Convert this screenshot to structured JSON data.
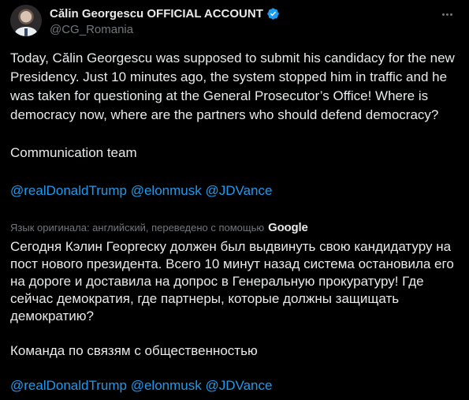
{
  "author": {
    "display_name": "Călin Georgescu OFFICIAL ACCOUNT",
    "handle": "@CG_Romania",
    "verified_icon": "verified-badge-icon",
    "more_icon": "more-horizontal-icon"
  },
  "original": {
    "paragraph1": "Today, Călin Georgescu was supposed to submit his candidacy for the new Presidency. Just 10 minutes ago, the system stopped him in traffic and he was taken for questioning at the General Prosecutor’s Office! Where is democracy now, where are the partners who should defend democracy?",
    "paragraph2": "Communication team",
    "mentions": [
      "@realDonaldTrump",
      "@elonmusk",
      "@JDVance"
    ]
  },
  "translation": {
    "note": "Язык оригинала: английский, переведено с помощью",
    "provider": "Google",
    "paragraph1": "Сегодня Кэлин Георгеску должен был выдвинуть свою кандидатуру на пост нового президента. Всего 10 минут назад система остановила его на дороге и доставила на допрос в Генеральную прокуратуру! Где сейчас демократия, где партнеры, которые должны защищать демократию?",
    "paragraph2": "Команда по связям с общественностью",
    "mentions": [
      "@realDonaldTrump",
      "@elonmusk",
      "@JDVance"
    ]
  },
  "colors": {
    "background": "#000000",
    "text": "#e7e9ea",
    "muted": "#71767b",
    "link": "#1d9bf0",
    "verified": "#1d9bf0"
  }
}
